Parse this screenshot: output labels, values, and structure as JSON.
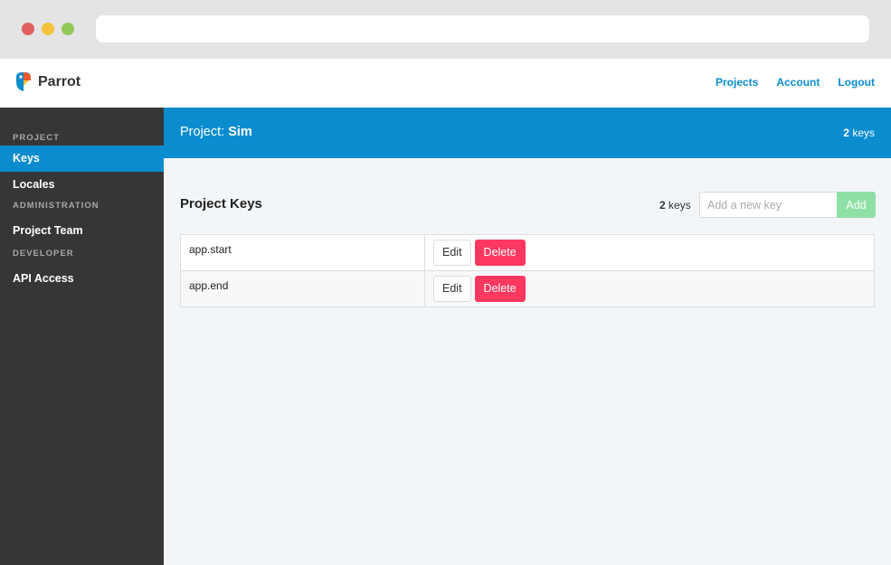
{
  "brand": {
    "name": "Parrot"
  },
  "nav": {
    "links": [
      "Projects",
      "Account",
      "Logout"
    ]
  },
  "sidebar": {
    "sections": [
      {
        "title": "PROJECT",
        "items": [
          {
            "label": "Keys",
            "active": true
          },
          {
            "label": "Locales",
            "active": false
          }
        ]
      },
      {
        "title": "ADMINISTRATION",
        "items": [
          {
            "label": "Project Team",
            "active": false
          }
        ]
      },
      {
        "title": "DEVELOPER",
        "items": [
          {
            "label": "API Access",
            "active": false
          }
        ]
      }
    ]
  },
  "project": {
    "prefix": "Project:",
    "name": "Sim",
    "key_count": "2",
    "key_unit": "keys"
  },
  "keys_panel": {
    "title": "Project Keys",
    "count": "2",
    "unit": "keys",
    "input_placeholder": "Add a new key",
    "add_label": "Add",
    "edit_label": "Edit",
    "delete_label": "Delete",
    "rows": [
      {
        "key": "app.start"
      },
      {
        "key": "app.end"
      }
    ]
  },
  "colors": {
    "accent": "#0a8ccf",
    "sidebar": "#363636",
    "danger": "#ff3860",
    "success_light": "#8fe0a6"
  }
}
